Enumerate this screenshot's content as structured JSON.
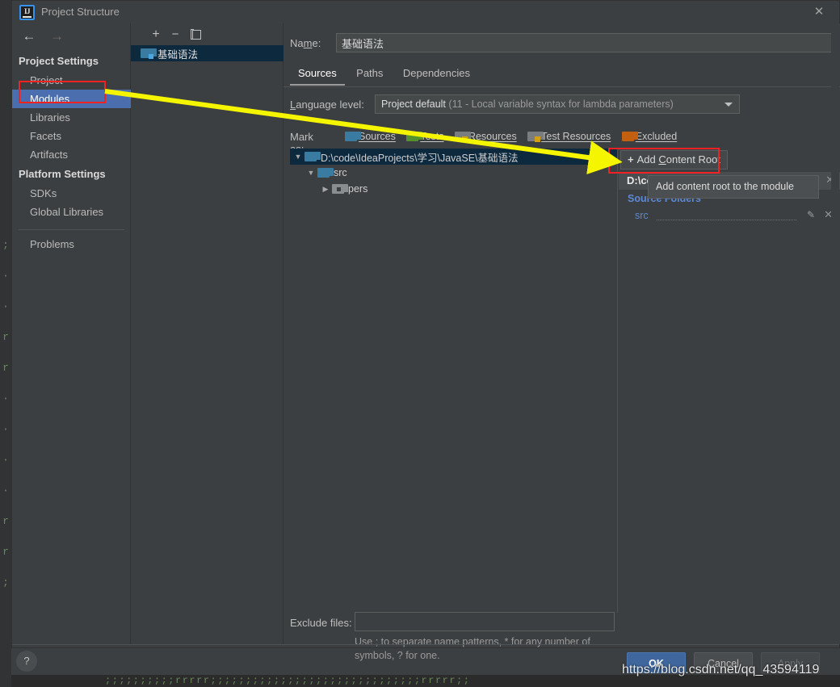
{
  "window": {
    "title": "Project Structure",
    "app_icon": "intellij-idea-icon",
    "close_label": "✕"
  },
  "sidebar": {
    "nav": {
      "back": "←",
      "forward": "→"
    },
    "groups": [
      {
        "header": "Project Settings",
        "items": [
          {
            "label": "Project",
            "selected": false
          },
          {
            "label": "Modules",
            "selected": true
          },
          {
            "label": "Libraries",
            "selected": false
          },
          {
            "label": "Facets",
            "selected": false
          },
          {
            "label": "Artifacts",
            "selected": false
          }
        ]
      },
      {
        "header": "Platform Settings",
        "items": [
          {
            "label": "SDKs",
            "selected": false
          },
          {
            "label": "Global Libraries",
            "selected": false
          }
        ]
      }
    ],
    "footer_item": "Problems"
  },
  "module_panel": {
    "toolbar": {
      "add": "+",
      "remove": "−",
      "copy": "copy-icon"
    },
    "modules": [
      {
        "label": "基础语法",
        "selected": true,
        "icon": "module-folder-icon"
      }
    ]
  },
  "main": {
    "name_field": {
      "label": "Name:",
      "label_mnemonic": "m",
      "value": "基础语法",
      "placeholder": ""
    },
    "tabs": [
      {
        "label": "Sources",
        "active": true
      },
      {
        "label": "Paths",
        "active": false
      },
      {
        "label": "Dependencies",
        "active": false
      }
    ],
    "language_level": {
      "label": "Language level:",
      "value": "Project default",
      "value_detail": "(11 - Local variable syntax for lambda parameters)"
    },
    "mark_as": {
      "label": "Mark as:",
      "options": [
        {
          "label": "Sources",
          "color": "#3a7ca1"
        },
        {
          "label": "Tests",
          "color": "#53922f"
        },
        {
          "label": "Resources",
          "color": "#7a7d80"
        },
        {
          "label": "Test Resources",
          "color": "#8a8d90"
        },
        {
          "label": "Excluded",
          "color": "#c2600f"
        }
      ]
    },
    "tree": [
      {
        "label": "D:\\code\\IdeaProjects\\学习\\JavaSE\\基础语法",
        "depth": 0,
        "twisty": "▼",
        "selected": true,
        "icon_color": "#3a7ca1"
      },
      {
        "label": "src",
        "depth": 1,
        "twisty": "▼",
        "selected": false,
        "icon_color": "#3a7ca1"
      },
      {
        "label": "pers",
        "depth": 2,
        "twisty": "▶",
        "selected": false,
        "icon_color": "#8a8d90"
      }
    ],
    "details": {
      "add_content_root_button": {
        "plus": "+",
        "pre": "Add ",
        "mnemonic": "C",
        "post": "ontent Root"
      },
      "root_path": "D:\\cod",
      "root_remove": "✕",
      "source_folders_title": "Source Folders",
      "source_folders": [
        {
          "name": "src",
          "edit_icon": "pencil-icon",
          "remove_icon": "✕"
        }
      ]
    },
    "tooltip": {
      "text": "Add content root to the module"
    },
    "exclude_files": {
      "label": "Exclude files:",
      "value": "",
      "hint": "Use ; to separate name patterns, * for any number of symbols, ? for one."
    }
  },
  "footer": {
    "help": "?",
    "buttons": [
      {
        "label": "OK",
        "primary": true
      },
      {
        "label": "Cancel",
        "primary": false
      },
      {
        "label": "Apply",
        "primary": false,
        "disabled": true
      }
    ]
  },
  "overlay": {
    "watermark": "https://blog.csdn.net/qq_43594119",
    "arrow_color": "#f5f500",
    "highlight_color": "#f02222",
    "highlights": [
      {
        "target": "sidebar-item-modules"
      },
      {
        "target": "add-content-root-button"
      }
    ]
  },
  "background": {
    "gutter_code": ";\n·\n·\nr\nr\n·\n·\n·\n·\nr\nr\n;",
    "bottom_code": ";;;;;;;;;;rrrrr;;;;;;;;;;;;;;;;;;;;;;;;;;;;;;rrrrr;;"
  }
}
